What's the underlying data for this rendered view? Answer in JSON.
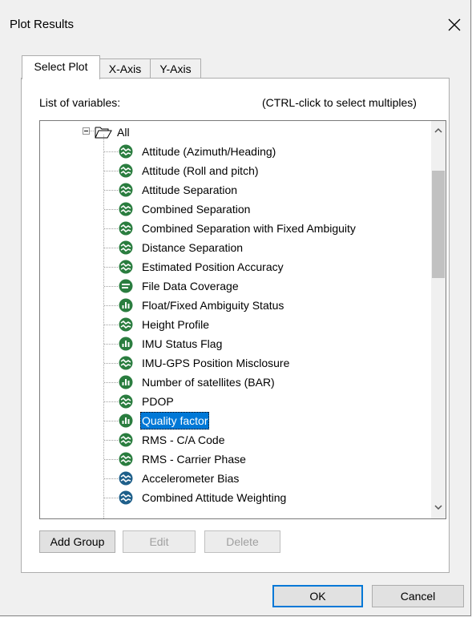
{
  "window": {
    "title": "Plot Results"
  },
  "tabs": [
    {
      "label": "Select Plot",
      "active": true
    },
    {
      "label": "X-Axis",
      "active": false
    },
    {
      "label": "Y-Axis",
      "active": false
    }
  ],
  "list_label": "List of variables:",
  "hint": "(CTRL-click to select multiples)",
  "tree": {
    "root": "All",
    "items": [
      {
        "label": "Attitude (Azimuth/Heading)",
        "icon": "line-chart-icon",
        "color": "#2a7d3f"
      },
      {
        "label": "Attitude (Roll and pitch)",
        "icon": "line-chart-icon",
        "color": "#2a7d3f"
      },
      {
        "label": "Attitude Separation",
        "icon": "line-chart-icon",
        "color": "#2a7d3f"
      },
      {
        "label": "Combined Separation",
        "icon": "line-chart-icon",
        "color": "#2a7d3f"
      },
      {
        "label": "Combined Separation with Fixed Ambiguity",
        "icon": "line-chart-icon",
        "color": "#2a7d3f"
      },
      {
        "label": "Distance Separation",
        "icon": "line-chart-icon",
        "color": "#2a7d3f"
      },
      {
        "label": "Estimated Position Accuracy",
        "icon": "line-chart-icon",
        "color": "#2a7d3f"
      },
      {
        "label": "File Data Coverage",
        "icon": "coverage-icon",
        "color": "#2a7d3f"
      },
      {
        "label": "Float/Fixed Ambiguity Status",
        "icon": "bar-chart-icon",
        "color": "#2a7d3f"
      },
      {
        "label": "Height Profile",
        "icon": "line-chart-icon",
        "color": "#2a7d3f"
      },
      {
        "label": "IMU Status Flag",
        "icon": "bar-chart-icon",
        "color": "#2a7d3f"
      },
      {
        "label": "IMU-GPS Position Misclosure",
        "icon": "line-chart-icon",
        "color": "#2a7d3f"
      },
      {
        "label": "Number of satellites (BAR)",
        "icon": "bar-chart-icon",
        "color": "#2a7d3f"
      },
      {
        "label": "PDOP",
        "icon": "line-chart-icon",
        "color": "#2a7d3f"
      },
      {
        "label": "Quality factor",
        "icon": "bar-chart-icon",
        "color": "#2a7d3f",
        "selected": true
      },
      {
        "label": "RMS - C/A Code",
        "icon": "line-chart-icon",
        "color": "#2a7d3f"
      },
      {
        "label": "RMS - Carrier Phase",
        "icon": "line-chart-icon",
        "color": "#2a7d3f"
      },
      {
        "label": "Accelerometer Bias",
        "icon": "line-chart-icon",
        "color": "#1e5f8a"
      },
      {
        "label": "Combined Attitude Weighting",
        "icon": "line-chart-icon",
        "color": "#1e5f8a"
      }
    ]
  },
  "buttons": {
    "add_group": "Add Group",
    "edit": "Edit",
    "delete": "Delete",
    "ok": "OK",
    "cancel": "Cancel"
  },
  "colors": {
    "selection": "#0078d7",
    "accent": "#0078d7"
  }
}
